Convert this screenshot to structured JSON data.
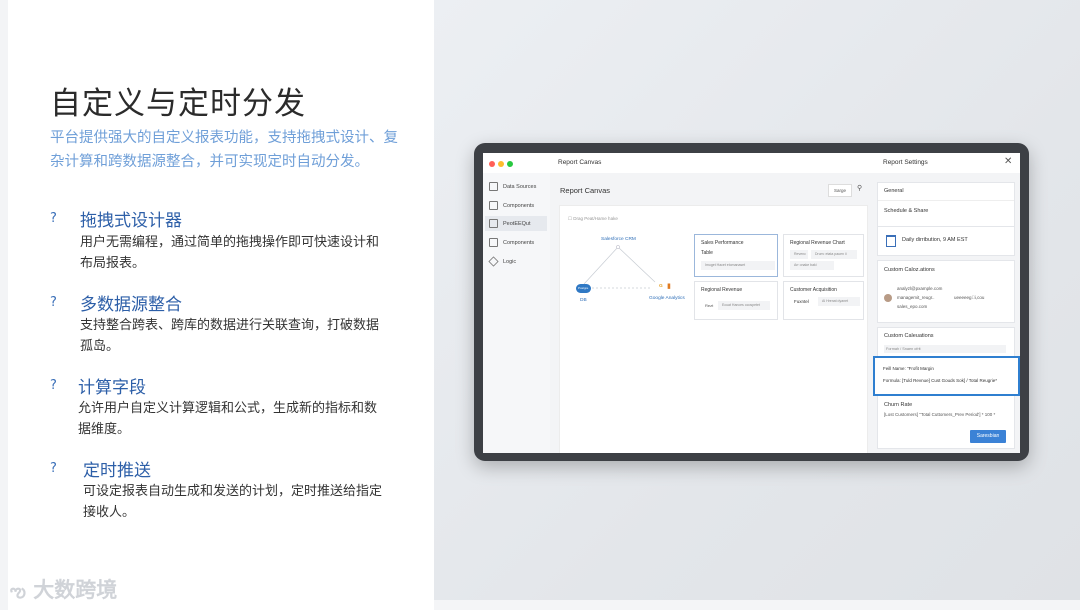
{
  "slide": {
    "title": "自定义与定时分发",
    "subtitle": "平台提供强大的自定义报表功能，支持拖拽式设计、复杂计算和跨数据源整合，并可实现定时自动分发。",
    "features": [
      {
        "icon": "?",
        "title": "拖拽式设计器",
        "desc": "用户无需编程，通过简单的拖拽操作即可快速设计和布局报表。"
      },
      {
        "icon": "?",
        "title": "多数据源整合",
        "desc": "支持整合跨表、跨库的数据进行关联查询，打破数据孤岛。"
      },
      {
        "icon": "?",
        "title": "计算字段",
        "desc": "允许用户自定义计算逻辑和公式，生成新的指标和数据维度。"
      },
      {
        "icon": "?",
        "title": "定时推送",
        "desc": "可设定报表自动生成和发送的计划，定时推送给指定接收人。"
      }
    ],
    "logo_text": "大数跨境"
  },
  "app": {
    "window_title": "Report Canvas",
    "settings_title": "Report Settings",
    "close": "✕",
    "sidebar": [
      {
        "label": "Data Sources",
        "icon": "database-icon"
      },
      {
        "label": "Components",
        "icon": "components-icon"
      },
      {
        "label": "PeotEEQut",
        "icon": "calculator-icon"
      },
      {
        "label": "Components",
        "icon": "components-icon"
      },
      {
        "label": "Logic",
        "icon": "logic-icon"
      }
    ],
    "canvas": {
      "title": "Report Canvas",
      "search_label": "Sarge",
      "search_icon": "🔍",
      "drag_hint": "Drag Peat/Hame hake",
      "nodes": {
        "crm": "Salesforce CRM",
        "db": "DB",
        "db_badge": "Postgre",
        "ga": "Google Analytics",
        "ga_icon": "G"
      },
      "cards": [
        {
          "title": "Sales Performance",
          "sub": "Table",
          "pill": "Imuget Hacet etomanaset"
        },
        {
          "title": "Regional Revenue Chart",
          "pill1": "Revenc",
          "pill2": "Drum: etata pauen ii",
          "pill3": "Arr onake baki"
        },
        {
          "title": "Regional Revenue",
          "pill_label": "Rezt",
          "pill": "Ecuat Hances ocospetet"
        },
        {
          "title": "Customer Acquisition",
          "pill_label": "Fuxntel",
          "pill": "Al Hrenat dyanet"
        }
      ]
    },
    "settings": {
      "general": "General",
      "schedule_share": "Schedule & Share",
      "schedule_value": "Daily dirribution, 9 AM EST",
      "custom_calc_1": "Custom Caloz.ations",
      "email1": "analyzl@pxample.com",
      "email2": "managemit_reugr..",
      "email3": "sales_epo.com",
      "email_right": "ueeeeeg\u0000i,cou",
      "custom_calc_2": "Custom Caleuations",
      "formula_hint": "Formah / Snaen ofrit",
      "field_name": "Feill Name: \"Frofit Margin",
      "formula": "Formula: [Tuld Revnue] Cust Gouds Sok] / Total Reugrie*",
      "churn_title": "Churn Rate",
      "churn_formula": "[Lost Customers] \"Total Cuttomers_Prev Period'] * 100 *",
      "save": "Saresbian"
    }
  }
}
